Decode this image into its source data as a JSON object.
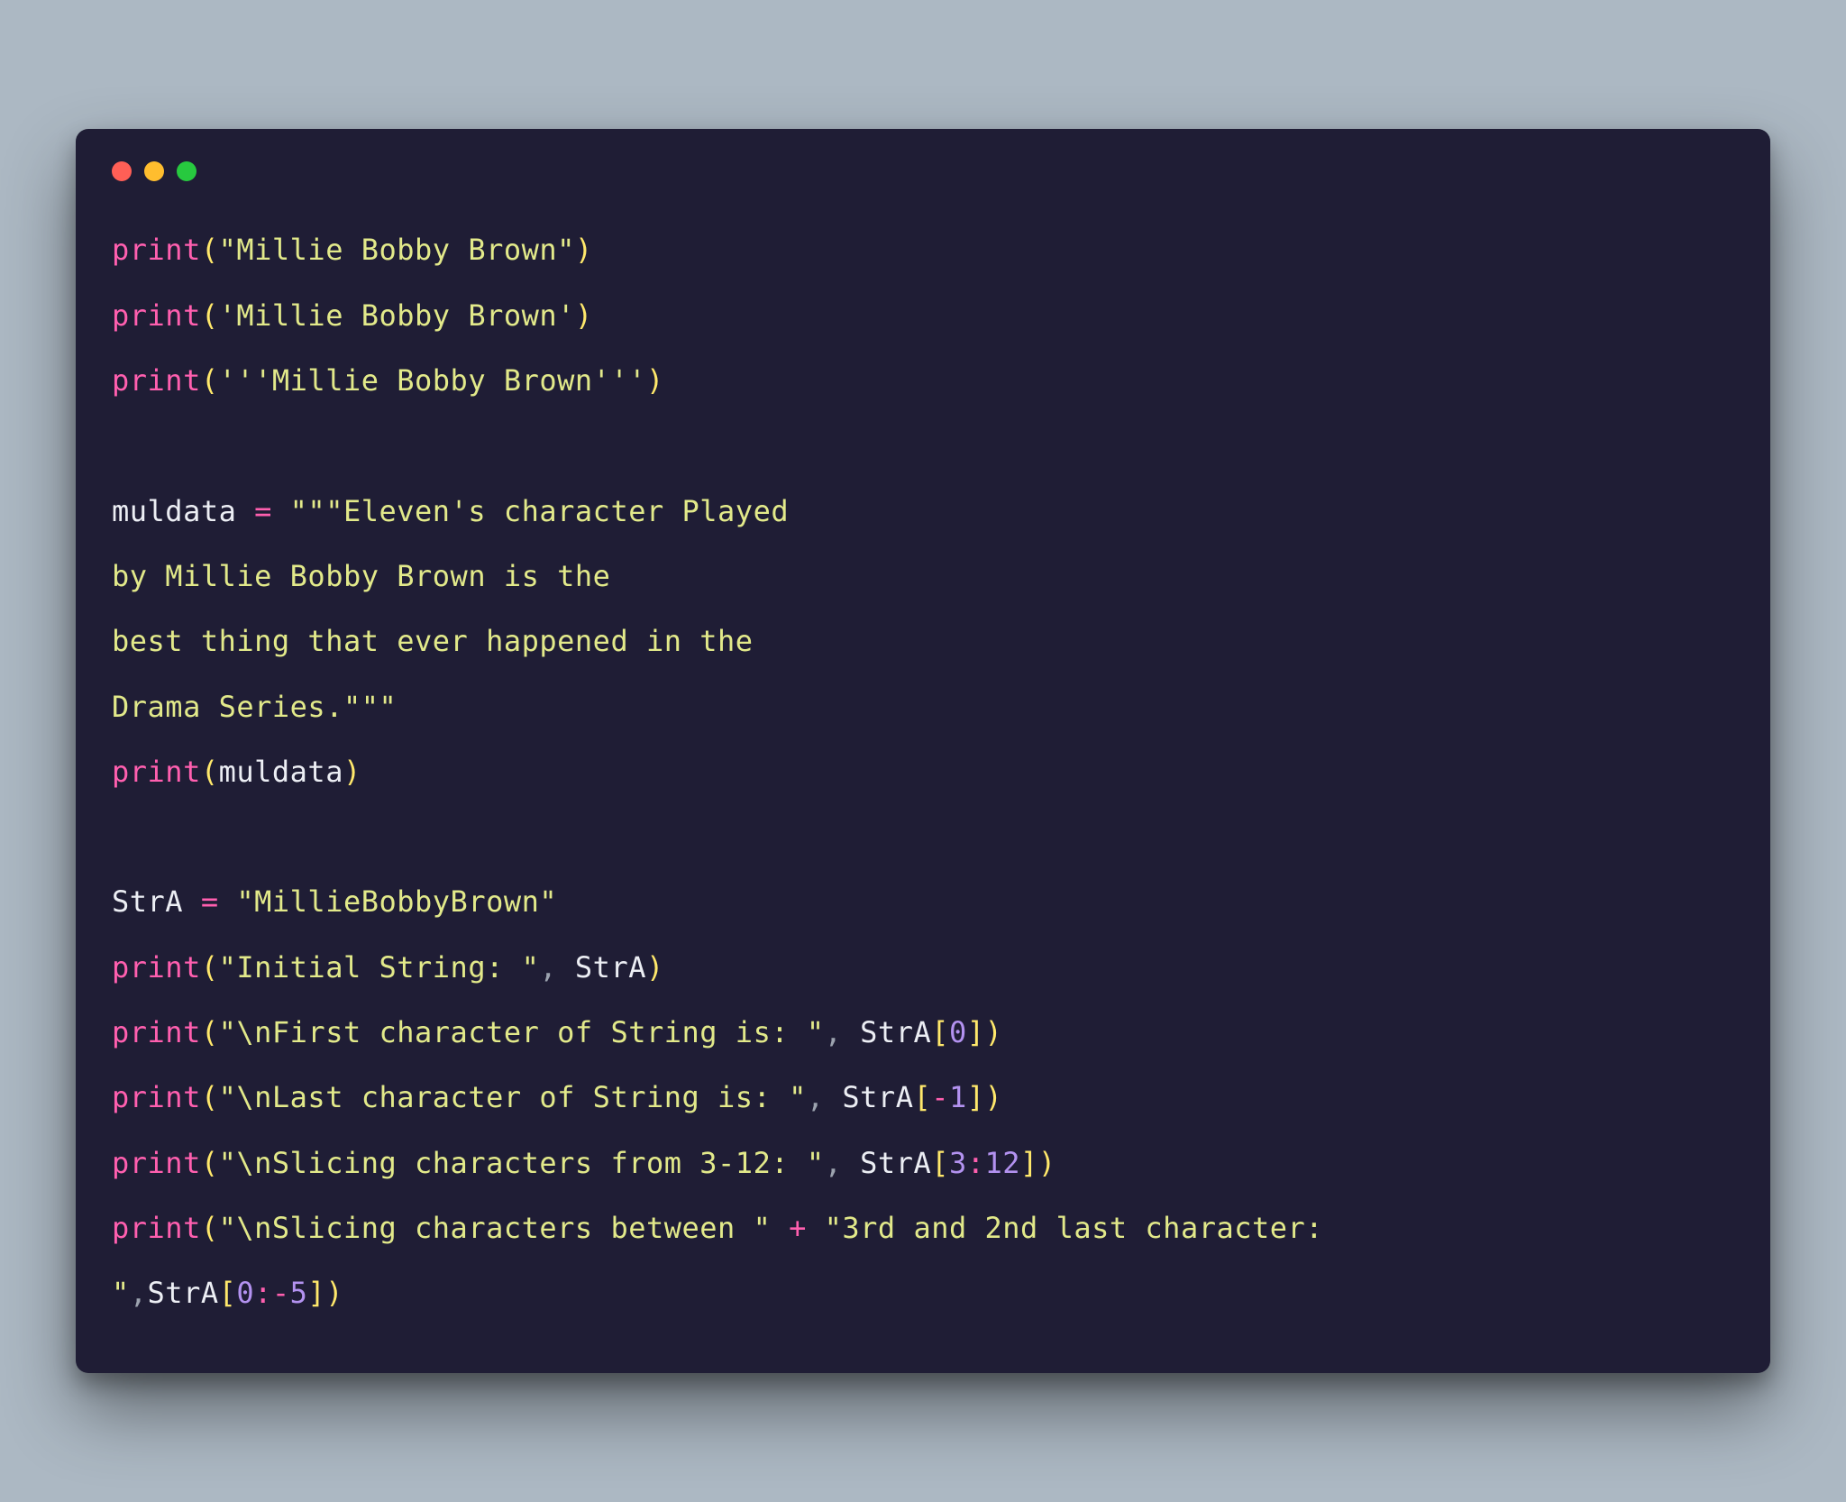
{
  "window": {
    "traffic": {
      "red": "#ff5f56",
      "yellow": "#ffbd2e",
      "green": "#27c93f"
    }
  },
  "code": {
    "t_print": "print",
    "lp": "(",
    "rp": ")",
    "lb": "[",
    "rb": "]",
    "eq": " = ",
    "plus": " + ",
    "colon": ":",
    "comma": ", ",
    "comma_ns": ",",
    "neg": "-",
    "l1_str": "\"Millie Bobby Brown\"",
    "l2_str": "'Millie Bobby Brown'",
    "l3_str": "'''Millie Bobby Brown'''",
    "l5_id": "muldata",
    "l5_str": "\"\"\"Eleven's character Played",
    "l6_str": "by Millie Bobby Brown is the",
    "l7_str": "best thing that ever happened in the",
    "l8_str": "Drama Series.\"\"\"",
    "l9_arg": "muldata",
    "l11_id": "StrA",
    "l11_str": "\"MillieBobbyBrown\"",
    "l12_str": "\"Initial String: \"",
    "l12_arg": "StrA",
    "l13_str": "\"\\nFirst character of String is: \"",
    "l13_arg": "StrA",
    "l13_idx": "0",
    "l14_str": "\"\\nLast character of String is: \"",
    "l14_arg": "StrA",
    "l14_idx": "1",
    "l15_str": "\"\\nSlicing characters from 3-12: \"",
    "l15_arg": "StrA",
    "l15_a": "3",
    "l15_b": "12",
    "l16_strA": "\"\\nSlicing characters between \"",
    "l16_strB": "\"3rd and 2nd last character: ",
    "l17_strC": "\"",
    "l17_arg": "StrA",
    "l17_a": "0",
    "l17_b": "5"
  }
}
